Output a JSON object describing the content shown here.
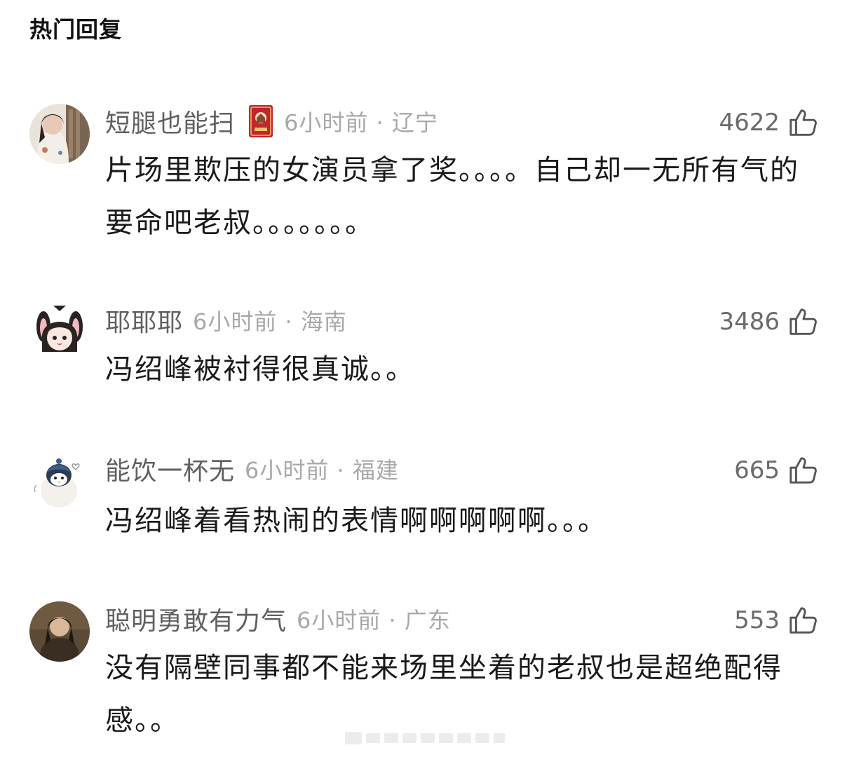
{
  "section": {
    "title": "热门回复"
  },
  "comments": [
    {
      "username": "短腿也能扫",
      "has_badge": true,
      "badge_icon": "red-book-badge-icon",
      "time_location": "6小时前 · 辽宁",
      "likes": "4622",
      "text": "片场里欺压的女演员拿了奖。。。。自己却一无所有气的要命吧老叔。。。。。。。"
    },
    {
      "username": "耶耶耶",
      "has_badge": false,
      "time_location": "6小时前 · 海南",
      "likes": "3486",
      "text": "冯绍峰被衬得很真诚。。"
    },
    {
      "username": "能饮一杯无",
      "has_badge": false,
      "time_location": "6小时前 · 福建",
      "likes": "665",
      "text": "冯绍峰着看热闹的表情啊啊啊啊啊。。。"
    },
    {
      "username": "聪明勇敢有力气",
      "has_badge": false,
      "time_location": "6小时前 · 广东",
      "likes": "553",
      "text": "没有隔壁同事都不能来场里坐着的老叔也是超绝配得感。。"
    }
  ],
  "icons": {
    "like": "thumbs-up-icon"
  },
  "colors": {
    "username": "#5f5f5f",
    "meta": "#a8a8a8",
    "text": "#1a1a1a",
    "like_count": "#6a6a6a",
    "badge_red": "#c0262c"
  }
}
